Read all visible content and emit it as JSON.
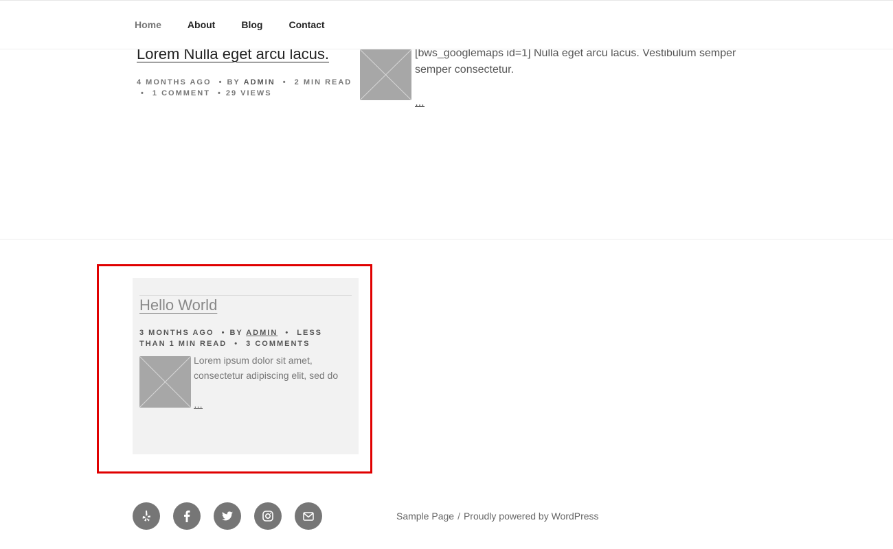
{
  "nav": {
    "items": [
      {
        "label": "Home",
        "active": true
      },
      {
        "label": "About",
        "active": false
      },
      {
        "label": "Blog",
        "active": false
      },
      {
        "label": "Contact",
        "active": false
      }
    ]
  },
  "post1": {
    "title": "Lorem Nulla eget arcu lacus.",
    "meta": {
      "time": "4 MONTHS AGO",
      "by": "BY",
      "author": "ADMIN",
      "read": "2 MIN READ",
      "comments": "1 COMMENT",
      "views": "29 VIEWS"
    },
    "excerpt": "[bws_googlemaps id=1] Nulla eget arcu lacus. Vestibulum semper semper consectetur.",
    "more": "…"
  },
  "card": {
    "title": "Hello World",
    "meta": {
      "time": "3 MONTHS AGO",
      "by": "BY",
      "author": "ADMIN",
      "read": "LESS THAN 1 MIN READ",
      "comments": "3 COMMENTS"
    },
    "excerpt": "Lorem ipsum dolor sit amet, consectetur adipiscing elit, sed do",
    "more": "…"
  },
  "social": {
    "icons": [
      "yelp-icon",
      "facebook-icon",
      "twitter-icon",
      "instagram-icon",
      "email-icon"
    ]
  },
  "footer": {
    "link1": "Sample Page",
    "separator": "/",
    "powered": "Proudly powered by WordPress"
  },
  "colors": {
    "highlight": "#e00000",
    "card_bg": "#f2f2f2",
    "social_bg": "#767676",
    "thumb_bg": "#a7a7a7"
  }
}
